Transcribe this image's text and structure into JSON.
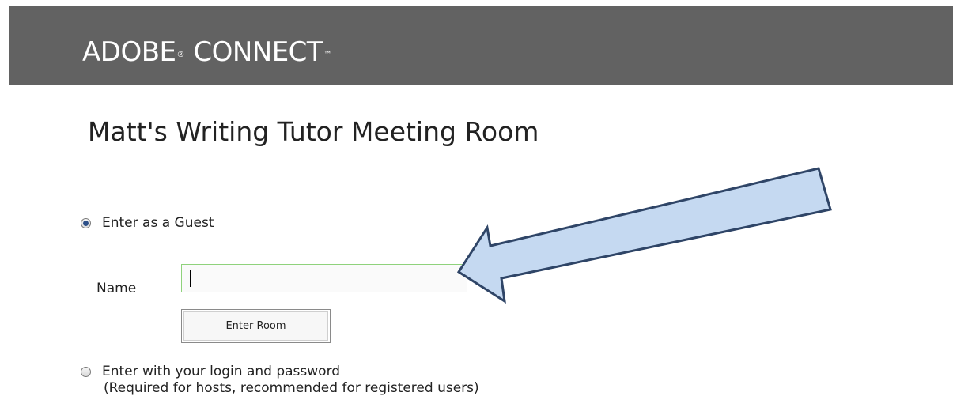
{
  "header": {
    "brand_part1": "ADOBE",
    "registered_mark": "®",
    "brand_part2": " CONNECT",
    "trademark_mark": "™"
  },
  "page_title": "Matt's Writing Tutor Meeting Room",
  "guest_option": {
    "label": "Enter as a Guest",
    "selected": true
  },
  "name_field": {
    "label": "Name",
    "value": ""
  },
  "enter_button": {
    "label": "Enter Room"
  },
  "login_option": {
    "label": "Enter with your login and password",
    "sublabel": "(Required for hosts, recommended for registered users)",
    "selected": false
  },
  "colors": {
    "header_bg": "#626262",
    "arrow_fill": "#c5d9f1",
    "arrow_stroke": "#2f4567",
    "input_border": "#8fd27c"
  },
  "icons": {
    "arrow": "annotation-arrow-icon"
  }
}
